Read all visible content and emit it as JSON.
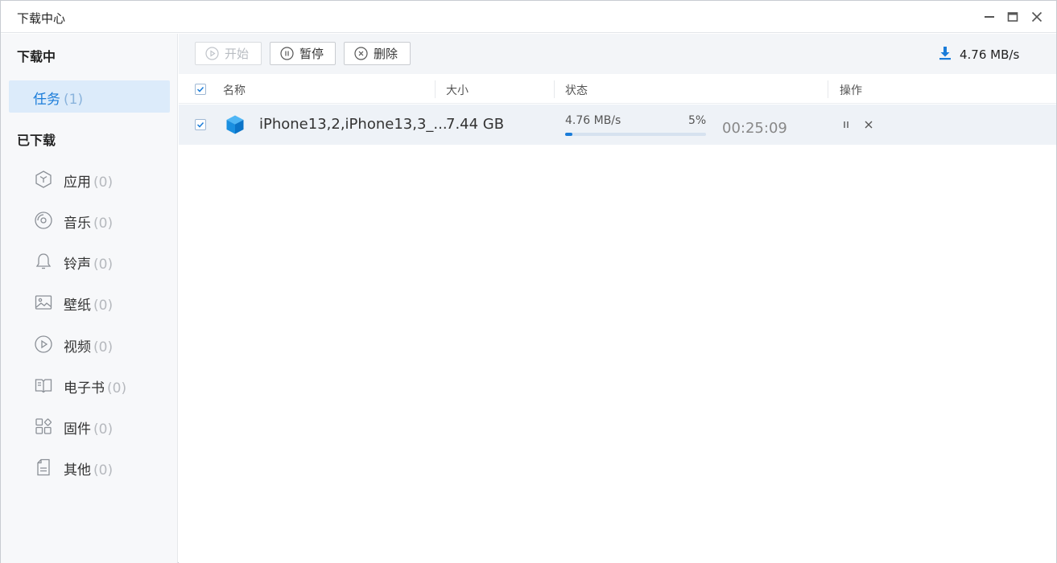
{
  "window": {
    "title": "下载中心"
  },
  "sidebar": {
    "downloading_title": "下载中",
    "task": {
      "label": "任务",
      "count": "(1)"
    },
    "downloaded_title": "已下载",
    "categories": [
      {
        "label": "应用",
        "count": "(0)",
        "icon": "cube-icon"
      },
      {
        "label": "音乐",
        "count": "(0)",
        "icon": "music-disc-icon"
      },
      {
        "label": "铃声",
        "count": "(0)",
        "icon": "bell-icon"
      },
      {
        "label": "壁纸",
        "count": "(0)",
        "icon": "image-icon"
      },
      {
        "label": "视频",
        "count": "(0)",
        "icon": "play-circle-icon"
      },
      {
        "label": "电子书",
        "count": "(0)",
        "icon": "book-icon"
      },
      {
        "label": "固件",
        "count": "(0)",
        "icon": "grid-icon"
      },
      {
        "label": "其他",
        "count": "(0)",
        "icon": "document-icon"
      }
    ]
  },
  "toolbar": {
    "start_label": "开始",
    "pause_label": "暂停",
    "delete_label": "删除",
    "total_speed": "4.76 MB/s"
  },
  "table": {
    "headers": {
      "name": "名称",
      "size": "大小",
      "status": "状态",
      "action": "操作"
    },
    "rows": [
      {
        "name": "iPhone13,2,iPhone13,3_...",
        "size": "7.44 GB",
        "speed": "4.76 MB/s",
        "percent": "5%",
        "progress": 0.05,
        "remaining": "00:25:09"
      }
    ]
  },
  "colors": {
    "accent": "#1a7cd9",
    "selected_bg": "#dcebfa",
    "row_bg": "#eef2f7"
  }
}
